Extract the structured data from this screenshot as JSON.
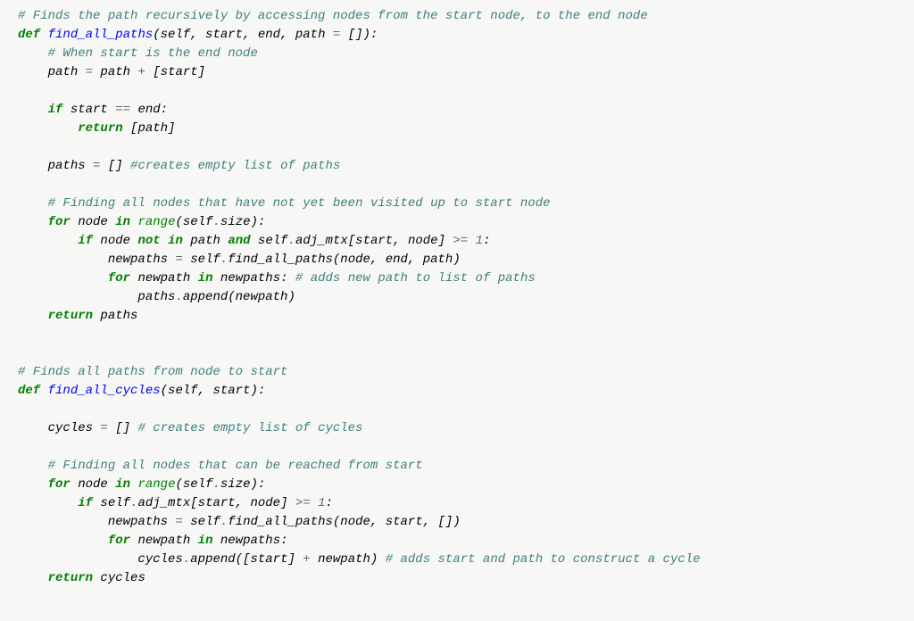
{
  "code": {
    "line1_comment": "# Finds the path recursively by accessing nodes from the start node, to the end node",
    "line2_def": "def",
    "line2_name": "find_all_paths",
    "line2_params": "(self, start, end, path ",
    "line2_eq": "=",
    "line2_default": " []):",
    "line3_comment": "# When start is the end node",
    "line4_path": "path ",
    "line4_eq": "=",
    "line4_rest": " path ",
    "line4_plus": "+",
    "line4_end": " [start]",
    "line5_if": "if",
    "line5_cond": " start ",
    "line5_eqeq": "==",
    "line5_end": " end:",
    "line6_return": "return",
    "line6_val": " [path]",
    "line7_paths": "paths ",
    "line7_eq": "=",
    "line7_empty": " [] ",
    "line7_comment": "#creates empty list of paths",
    "line8_comment": "# Finding all nodes that have not yet been visited up to start node",
    "line9_for": "for",
    "line9_node": " node ",
    "line9_in": "in",
    "line9_sp": " ",
    "line9_range": "range",
    "line9_args": "(self",
    "line9_dot": ".",
    "line9_end": "size):",
    "line10_if": "if",
    "line10_a": " node ",
    "line10_not": "not",
    "line10_sp1": " ",
    "line10_in": "in",
    "line10_b": " path ",
    "line10_and": "and",
    "line10_c": " self",
    "line10_d": ".",
    "line10_e": "adj_mtx[start, node] ",
    "line10_gte": ">=",
    "line10_sp2": " ",
    "line10_one": "1",
    "line10_colon": ":",
    "line11_a": "newpaths ",
    "line11_eq": "=",
    "line11_b": " self",
    "line11_c": ".",
    "line11_d": "find_all_paths(node, end, path)",
    "line12_for": "for",
    "line12_a": " newpath ",
    "line12_in": "in",
    "line12_b": " newpaths: ",
    "line12_comment": "# adds new path to list of paths",
    "line13_a": "paths",
    "line13_b": ".",
    "line13_c": "append(newpath)",
    "line14_return": "return",
    "line14_val": " paths",
    "line15_comment": "# Finds all paths from node to start",
    "line16_def": "def",
    "line16_name": "find_all_cycles",
    "line16_params": "(self, start):",
    "line17_a": "cycles ",
    "line17_eq": "=",
    "line17_b": " [] ",
    "line17_comment": "# creates empty list of cycles",
    "line18_comment": "# Finding all nodes that can be reached from start",
    "line19_for": "for",
    "line19_a": " node ",
    "line19_in": "in",
    "line19_sp": " ",
    "line19_range": "range",
    "line19_b": "(self",
    "line19_c": ".",
    "line19_d": "size):",
    "line20_if": "if",
    "line20_a": " self",
    "line20_b": ".",
    "line20_c": "adj_mtx[start, node] ",
    "line20_gte": ">=",
    "line20_sp": " ",
    "line20_one": "1",
    "line20_colon": ":",
    "line21_a": "newpaths ",
    "line21_eq": "=",
    "line21_b": " self",
    "line21_c": ".",
    "line21_d": "find_all_paths(node, start, [])",
    "line22_for": "for",
    "line22_a": " newpath ",
    "line22_in": "in",
    "line22_b": " newpaths:",
    "line23_a": "cycles",
    "line23_b": ".",
    "line23_c": "append([start] ",
    "line23_plus": "+",
    "line23_d": " newpath) ",
    "line23_comment": "# adds start and path to construct a cycle",
    "line24_return": "return",
    "line24_val": " cycles"
  }
}
